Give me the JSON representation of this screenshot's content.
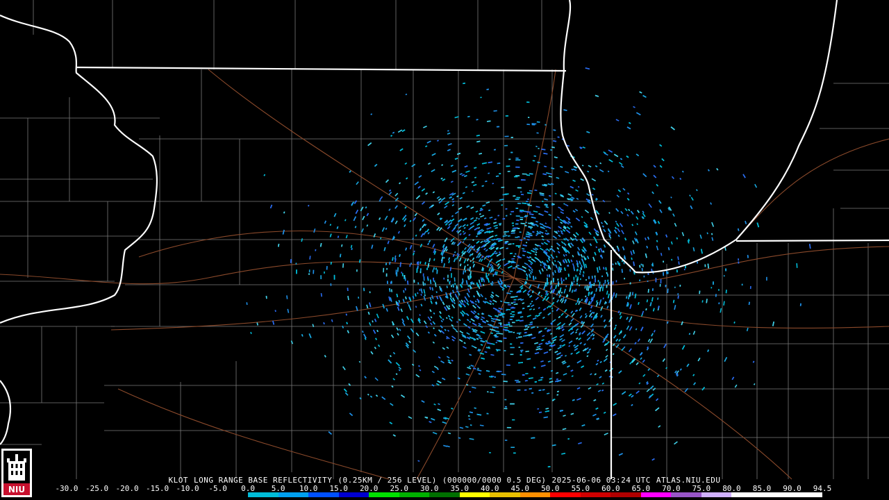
{
  "caption": {
    "station": "KLOT",
    "product": "LONG RANGE BASE REFLECTIVITY",
    "resolution": "(0.25KM / 256 LEVEL)",
    "volume": "(000000/0000 0.5 DEG)",
    "datetime": "2025-06-06 03:24 UTC",
    "credit": "ATLAS.NIU.EDU"
  },
  "legend": {
    "labels": [
      "-30.0",
      "-25.0",
      "-20.0",
      "-15.0",
      "-10.0",
      "-5.0",
      "0.0",
      "5.0",
      "10.0",
      "15.0",
      "20.0",
      "25.0",
      "30.0",
      "35.0",
      "40.0",
      "45.0",
      "50.0",
      "55.0",
      "60.0",
      "65.0",
      "70.0",
      "75.0",
      "80.0",
      "85.0",
      "90.0",
      "94.5"
    ],
    "colors": [
      "#000000",
      "#000000",
      "#000000",
      "#000000",
      "#000000",
      "#000000",
      "#00bcd8",
      "#00a0f0",
      "#0050ff",
      "#0000d0",
      "#00e000",
      "#00b000",
      "#007000",
      "#ffff00",
      "#e8c000",
      "#ff9000",
      "#ff0000",
      "#d00000",
      "#b00000",
      "#ff00ff",
      "#9855c8",
      "#d0b0ff",
      "#ffffff",
      "#ffffff",
      "#ffffff"
    ]
  },
  "logo": {
    "text": "NIU",
    "color": "#c8102e"
  },
  "map": {
    "background": "#000000",
    "state_line_color": "#ffffff",
    "county_line_color": "#7a7a7a",
    "road_color": "#8b4a2b",
    "echo_colors": [
      "#00bcd8",
      "#18a8e0",
      "#1e8fe6",
      "#2a6cf0",
      "#40d0e8"
    ]
  }
}
